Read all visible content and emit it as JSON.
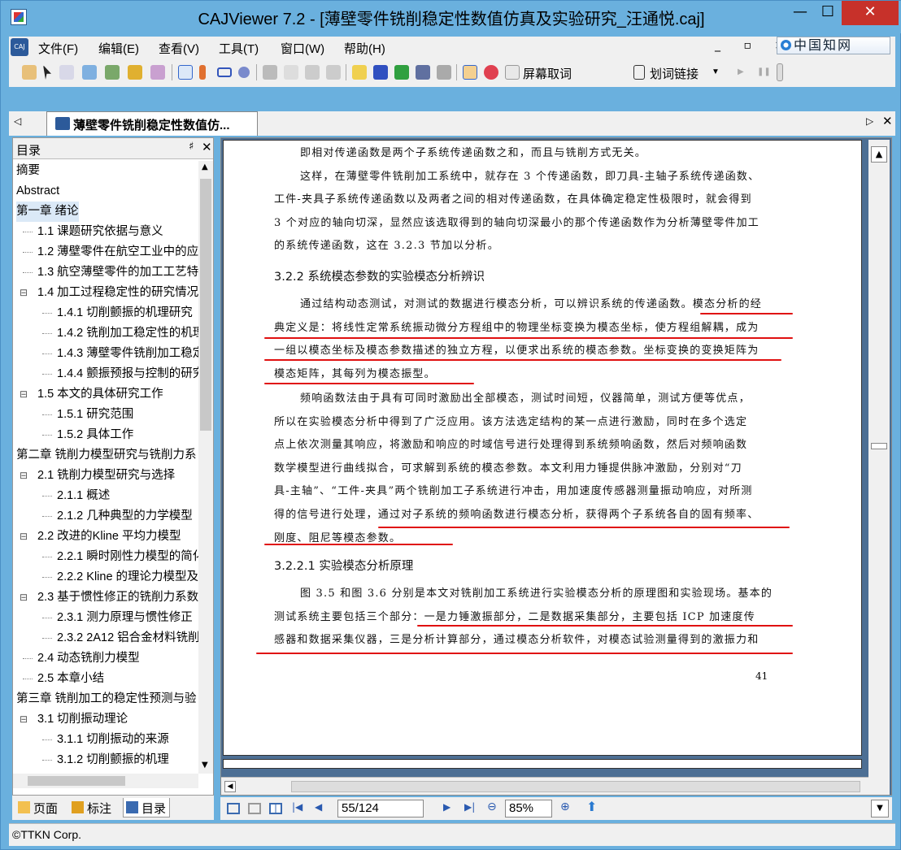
{
  "window": {
    "title": "CAJViewer 7.2 - [薄壁零件铣削稳定性数值仿真及实验研究_汪通悦.caj]",
    "min_glyph": "—",
    "max_glyph": "☐",
    "close_glyph": "✕"
  },
  "menu": {
    "items": [
      "文件(F)",
      "编辑(E)",
      "查看(V)",
      "工具(T)",
      "窗口(W)",
      "帮助(H)"
    ],
    "mdi_controls": "_ ▫ ×",
    "brand": "中国知网"
  },
  "toolbar": {
    "screen_fetch_label": "屏幕取词",
    "word_link_label": "划词链接"
  },
  "tabs": {
    "doc_tab_label": "薄壁零件铣削稳定性数值仿...",
    "prev_glyph": "◁",
    "next_glyph": "▷",
    "close_glyph": "✕"
  },
  "left_panel": {
    "title": "目录",
    "pin_glyph": "♯",
    "close_glyph": "✕",
    "toc": [
      {
        "label": "摘要",
        "level": 0
      },
      {
        "label": "Abstract",
        "level": 0
      },
      {
        "label": "第一章 绪论",
        "level": 0,
        "selected": true
      },
      {
        "label": "1.1 课题研究依据与意义",
        "level": 1
      },
      {
        "label": "1.2 薄壁零件在航空工业中的应",
        "level": 1
      },
      {
        "label": "1.3 航空薄壁零件的加工工艺特",
        "level": 1
      },
      {
        "label": "1.4 加工过程稳定性的研究情况",
        "level": 1,
        "expander": "−"
      },
      {
        "label": "1.4.1 切削颤振的机理研究",
        "level": 2
      },
      {
        "label": "1.4.2 铣削加工稳定性的机理",
        "level": 2
      },
      {
        "label": "1.4.3 薄壁零件铣削加工稳定",
        "level": 2
      },
      {
        "label": "1.4.4 颤振预报与控制的研究",
        "level": 2
      },
      {
        "label": "1.5 本文的具体研究工作",
        "level": 1,
        "expander": "−"
      },
      {
        "label": "1.5.1 研究范围",
        "level": 2
      },
      {
        "label": "1.5.2 具体工作",
        "level": 2
      },
      {
        "label": "第二章 铣削力模型研究与铣削力系",
        "level": 0
      },
      {
        "label": "2.1 铣削力模型研究与选择",
        "level": 1,
        "expander": "−"
      },
      {
        "label": "2.1.1 概述",
        "level": 2
      },
      {
        "label": "2.1.2 几种典型的力学模型",
        "level": 2
      },
      {
        "label": "2.2 改进的Kline 平均力模型",
        "level": 1,
        "expander": "−"
      },
      {
        "label": "2.2.1 瞬时刚性力模型的简化",
        "level": 2
      },
      {
        "label": "2.2.2 Kline 的理论力模型及",
        "level": 2
      },
      {
        "label": "2.3 基于惯性修正的铣削力系数",
        "level": 1,
        "expander": "−"
      },
      {
        "label": "2.3.1 测力原理与惯性修正",
        "level": 2
      },
      {
        "label": "2.3.2 2A12 铝合金材料铣削",
        "level": 2
      },
      {
        "label": "2.4 动态铣削力模型",
        "level": 1
      },
      {
        "label": "2.5 本章小结",
        "level": 1
      },
      {
        "label": "第三章 铣削加工的稳定性预测与验",
        "level": 0
      },
      {
        "label": "3.1 切削振动理论",
        "level": 1,
        "expander": "−"
      },
      {
        "label": "3.1.1 切削振动的来源",
        "level": 2
      },
      {
        "label": "3.1.2 切削颤振的机理",
        "level": 2
      }
    ],
    "bottom_tabs": [
      "页面",
      "标注",
      "目录"
    ]
  },
  "document": {
    "lines": [
      "即相对传递函数是两个子系统传递函数之和，而且与铣削方式无关。",
      "这样，在薄壁零件铣削加工系统中，就存在 3 个传递函数，即刀具-主轴子系统传递函数、",
      "工件-夹具子系统传递函数以及两者之间的相对传递函数，在具体确定稳定性极限时，就会得到",
      "3 个对应的轴向切深，显然应该选取得到的轴向切深最小的那个传递函数作为分析薄壁零件加工",
      "的系统传递函数，这在 3.2.3 节加以分析。"
    ],
    "heading_322": "3.2.2 系统模态参数的实验模态分析辨识",
    "para2": [
      "通过结构动态测试，对测试的数据进行模态分析，可以辨识系统的传递函数。模态分析的经",
      "典定义是：将线性定常系统振动微分方程组中的物理坐标变换为模态坐标，使方程组解耦，成为",
      "一组以模态坐标及模态参数描述的独立方程，以便求出系统的模态参数。坐标变换的变换矩阵为",
      "模态矩阵，其每列为模态振型。"
    ],
    "para3": [
      "频响函数法由于具有可同时激励出全部模态，测试时间短，仪器简单，测试方便等优点，",
      "所以在实验模态分析中得到了广泛应用。该方法选定结构的某一点进行激励，同时在多个选定",
      "点上依次测量其响应，将激励和响应的时域信号进行处理得到系统频响函数，然后对频响函数",
      "数学模型进行曲线拟合，可求解到系统的模态参数。本文利用力锤提供脉冲激励，分别对“刀",
      "具-主轴”、“工件-夹具”两个铣削加工子系统进行冲击，用加速度传感器测量振动响应，对所测",
      "得的信号进行处理，通过对子系统的频响函数进行模态分析，获得两个子系统各自的固有频率、",
      "刚度、阻尼等模态参数。"
    ],
    "heading_3221": "3.2.2.1 实验模态分析原理",
    "para4": [
      "图 3.5 和图 3.6 分别是本文对铣削加工系统进行实验模态分析的原理图和实验现场。基本的",
      "测试系统主要包括三个部分：一是力锤激振部分，二是数据采集部分，主要包括 ICP 加速度传",
      "感器和数据采集仪器，三是分析计算部分，通过模态分析软件，对模态试验测量得到的激振力和"
    ],
    "page_number": "41"
  },
  "navbar": {
    "page_value": "55/124",
    "zoom_value": "85%"
  },
  "status": {
    "text": "©TTKN Corp."
  },
  "colors": {
    "titlebar": "#6ab0de",
    "close_button": "#c7312a",
    "annotation_underline": "#e01010",
    "doc_background": "#4d6f94"
  }
}
